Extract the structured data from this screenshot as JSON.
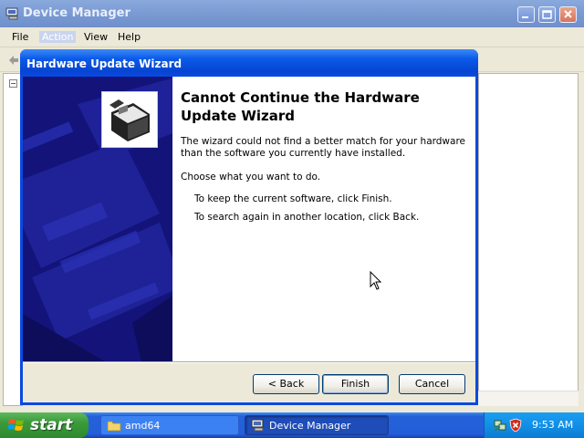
{
  "device_manager": {
    "title": "Device Manager",
    "menu": {
      "file": "File",
      "action": "Action",
      "view": "View",
      "help": "Help"
    },
    "tree_expander": "−"
  },
  "wizard": {
    "title": "Hardware Update Wizard",
    "heading": "Cannot Continue the Hardware Update Wizard",
    "description": "The wizard could not find a better match for your hardware than the software you currently have installed.",
    "prompt": "Choose what you want to do.",
    "option_finish": "To keep the current software, click Finish.",
    "option_back": "To search again in another location, click Back.",
    "buttons": {
      "back": "< Back",
      "finish": "Finish",
      "cancel": "Cancel"
    }
  },
  "taskbar": {
    "start_label": "start",
    "tasks": [
      {
        "label": "amd64",
        "icon": "folder-icon"
      },
      {
        "label": "Device Manager",
        "icon": "device-manager-icon"
      }
    ],
    "clock": "9:53 AM"
  },
  "colors": {
    "wizard_title_blue": "#0a5ae8",
    "taskbar_blue": "#245edb",
    "start_green": "#3a9a3a",
    "banner_navy": "#13137a"
  }
}
